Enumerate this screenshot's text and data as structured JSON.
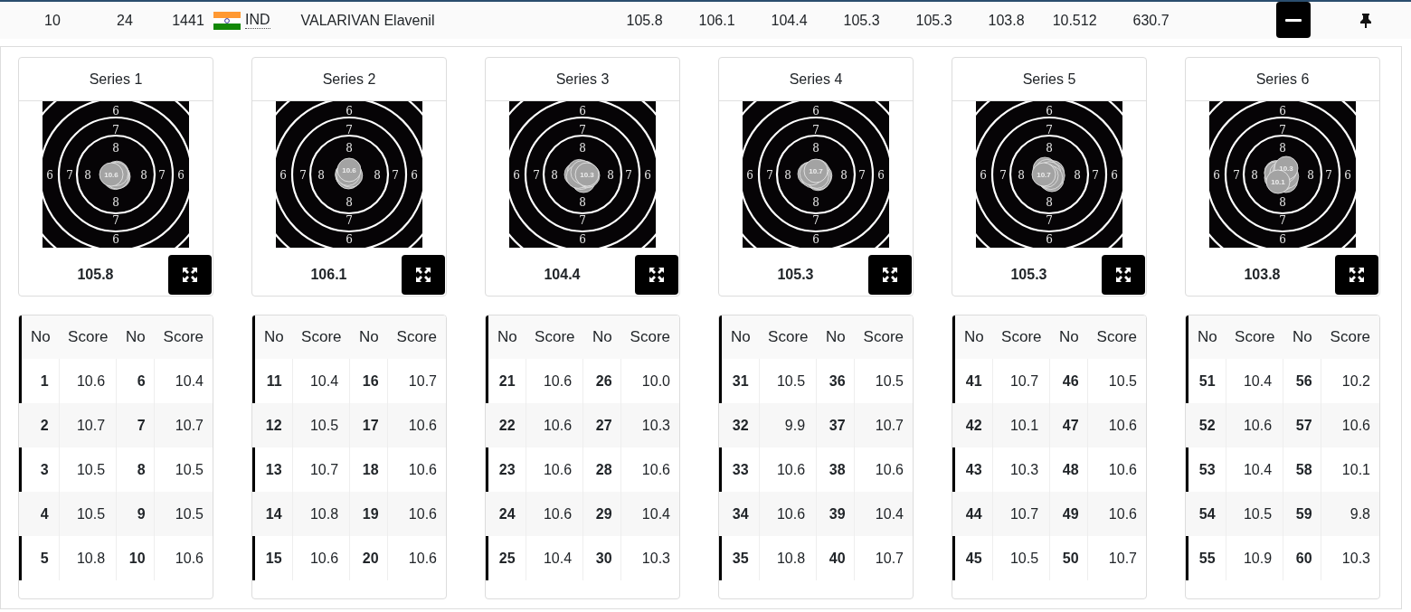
{
  "row": {
    "cells": [
      "10",
      "24",
      "1441"
    ],
    "country": "IND",
    "name": "VALARIVAN Elavenil",
    "scores": [
      "105.8",
      "106.1",
      "104.4",
      "105.3",
      "105.3",
      "103.8",
      "10.512",
      "630.7"
    ],
    "expanded": true
  },
  "series": [
    {
      "title": "Series 1",
      "total": "105.8",
      "target": {
        "ring_labels": [
          "6",
          "7",
          "8",
          "8",
          "7",
          "6",
          "6",
          "7",
          "8",
          "8",
          "7",
          "6"
        ],
        "shot_labels": [
          "10.6"
        ]
      },
      "columns": [
        "No",
        "Score",
        "No",
        "Score"
      ],
      "rows": [
        [
          "1",
          "10.6",
          "6",
          "10.4"
        ],
        [
          "2",
          "10.7",
          "7",
          "10.7"
        ],
        [
          "3",
          "10.5",
          "8",
          "10.5"
        ],
        [
          "4",
          "10.5",
          "9",
          "10.5"
        ],
        [
          "5",
          "10.8",
          "10",
          "10.6"
        ]
      ]
    },
    {
      "title": "Series 2",
      "total": "106.1",
      "target": {
        "ring_labels": [
          "6",
          "7",
          "8",
          "8",
          "7",
          "6",
          "6",
          "7",
          "8",
          "8",
          "7",
          "6"
        ],
        "shot_labels": [
          "10.6"
        ]
      },
      "columns": [
        "No",
        "Score",
        "No",
        "Score"
      ],
      "rows": [
        [
          "11",
          "10.4",
          "16",
          "10.7"
        ],
        [
          "12",
          "10.5",
          "17",
          "10.6"
        ],
        [
          "13",
          "10.7",
          "18",
          "10.6"
        ],
        [
          "14",
          "10.8",
          "19",
          "10.6"
        ],
        [
          "15",
          "10.6",
          "20",
          "10.6"
        ]
      ]
    },
    {
      "title": "Series 3",
      "total": "104.4",
      "target": {
        "ring_labels": [
          "6",
          "7",
          "8",
          "8",
          "7",
          "6",
          "6",
          "7",
          "8",
          "8",
          "7",
          "6"
        ],
        "shot_labels": [
          "10.3"
        ]
      },
      "columns": [
        "No",
        "Score",
        "No",
        "Score"
      ],
      "rows": [
        [
          "21",
          "10.6",
          "26",
          "10.0"
        ],
        [
          "22",
          "10.6",
          "27",
          "10.3"
        ],
        [
          "23",
          "10.6",
          "28",
          "10.6"
        ],
        [
          "24",
          "10.6",
          "29",
          "10.4"
        ],
        [
          "25",
          "10.4",
          "30",
          "10.3"
        ]
      ]
    },
    {
      "title": "Series 4",
      "total": "105.3",
      "target": {
        "ring_labels": [
          "6",
          "7",
          "8",
          "8",
          "7",
          "6",
          "6",
          "7",
          "8",
          "8",
          "7",
          "6"
        ],
        "shot_labels": [
          "10.7"
        ]
      },
      "columns": [
        "No",
        "Score",
        "No",
        "Score"
      ],
      "rows": [
        [
          "31",
          "10.5",
          "36",
          "10.5"
        ],
        [
          "32",
          "9.9",
          "37",
          "10.7"
        ],
        [
          "33",
          "10.6",
          "38",
          "10.6"
        ],
        [
          "34",
          "10.6",
          "39",
          "10.4"
        ],
        [
          "35",
          "10.8",
          "40",
          "10.7"
        ]
      ]
    },
    {
      "title": "Series 5",
      "total": "105.3",
      "target": {
        "ring_labels": [
          "6",
          "7",
          "8",
          "8",
          "7",
          "6",
          "6",
          "7",
          "8",
          "8",
          "7",
          "6"
        ],
        "shot_labels": [
          "10.7"
        ]
      },
      "columns": [
        "No",
        "Score",
        "No",
        "Score"
      ],
      "rows": [
        [
          "41",
          "10.7",
          "46",
          "10.5"
        ],
        [
          "42",
          "10.1",
          "47",
          "10.6"
        ],
        [
          "43",
          "10.3",
          "48",
          "10.6"
        ],
        [
          "44",
          "10.7",
          "49",
          "10.6"
        ],
        [
          "45",
          "10.5",
          "50",
          "10.7"
        ]
      ]
    },
    {
      "title": "Series 6",
      "total": "103.8",
      "target": {
        "ring_labels": [
          "6",
          "7",
          "8",
          "8",
          "7",
          "6",
          "6",
          "7",
          "8",
          "8",
          "7",
          "6"
        ],
        "shot_labels": [
          "10.3",
          "10.1"
        ]
      },
      "columns": [
        "No",
        "Score",
        "No",
        "Score"
      ],
      "rows": [
        [
          "51",
          "10.4",
          "56",
          "10.2"
        ],
        [
          "52",
          "10.6",
          "57",
          "10.6"
        ],
        [
          "53",
          "10.4",
          "58",
          "10.1"
        ],
        [
          "54",
          "10.5",
          "59",
          "9.8"
        ],
        [
          "55",
          "10.9",
          "60",
          "10.3"
        ]
      ]
    }
  ]
}
